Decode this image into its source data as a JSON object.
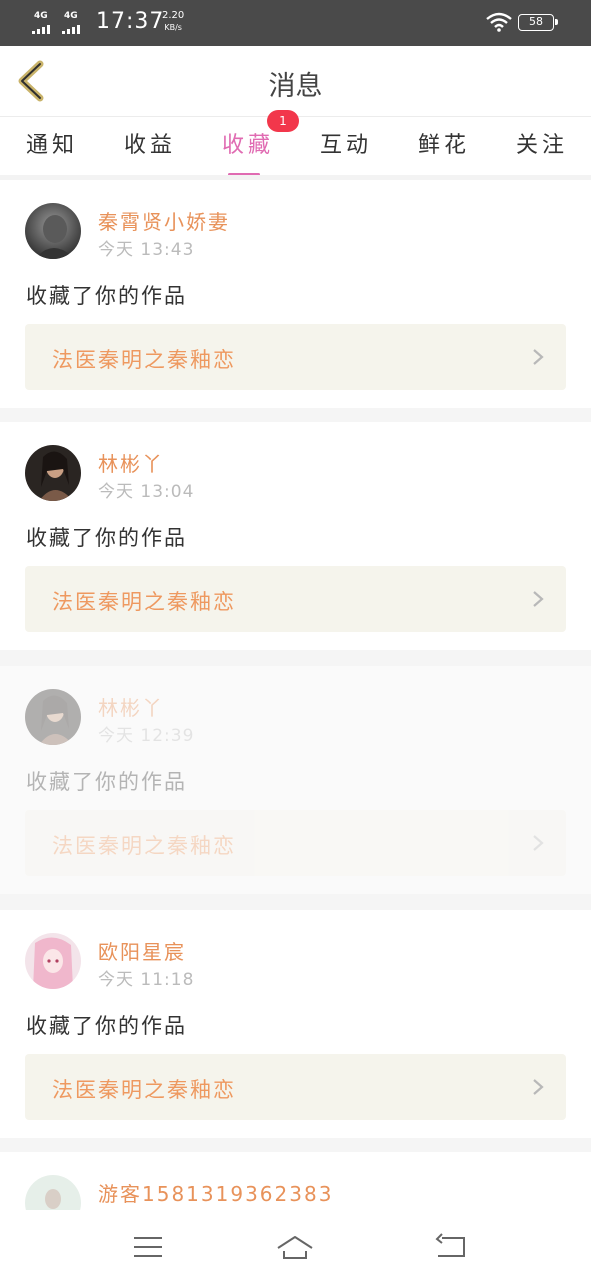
{
  "status": {
    "net1": "4G",
    "net2": "4G",
    "time": "17:37",
    "speed_value": "2.20",
    "speed_unit": "KB/s",
    "battery": "58"
  },
  "header": {
    "title": "消息"
  },
  "tabs": [
    {
      "label": "通知"
    },
    {
      "label": "收益"
    },
    {
      "label": "收藏",
      "active": true,
      "badge": "1"
    },
    {
      "label": "互动"
    },
    {
      "label": "鲜花"
    },
    {
      "label": "关注"
    }
  ],
  "messages": [
    {
      "user": "秦霄贤小娇妻",
      "time": "今天 13:43",
      "text": "收藏了你的作品",
      "work": "法医秦明之秦釉恋"
    },
    {
      "user": "林彬丫",
      "time": "今天 13:04",
      "text": "收藏了你的作品",
      "work": "法医秦明之秦釉恋"
    },
    {
      "user": "林彬丫",
      "time": "今天 12:39",
      "text": "收藏了你的作品",
      "work": "法医秦明之秦釉恋"
    },
    {
      "user": "欧阳星宸",
      "time": "今天 11:18",
      "text": "收藏了你的作品",
      "work": "法医秦明之秦釉恋"
    },
    {
      "user": "游客15813193623​83",
      "time": "",
      "text": "",
      "work": ""
    }
  ],
  "colors": {
    "accent": "#e06bb2",
    "username": "#e8925a",
    "badge": "#f2374b",
    "work_bg": "#f5f4ec"
  }
}
